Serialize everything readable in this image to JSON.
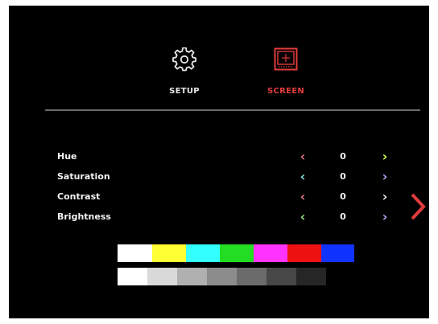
{
  "tabs": [
    {
      "label": "SETUP",
      "icon": "gear-icon",
      "color": "#e8e8e8",
      "active": false
    },
    {
      "label": "SCREEN",
      "icon": "screen-icon",
      "color": "#e23b3b",
      "active": true
    }
  ],
  "settings": [
    {
      "label": "Hue",
      "value": "0"
    },
    {
      "label": "Saturation",
      "value": "0"
    },
    {
      "label": "Contrast",
      "value": "0"
    },
    {
      "label": "Brightness",
      "value": "0"
    }
  ],
  "controls": {
    "decrease_glyph": "‹",
    "increase_glyph": "›",
    "decrease_color": "#e07080",
    "increase_color": "#b8a6ff",
    "next_page_icon": "chevron-right-icon",
    "next_page_color": "#e23b3b"
  },
  "color_bars": [
    "#ffffff",
    "#ffff33",
    "#33ffff",
    "#22dd22",
    "#ff33ff",
    "#ee1111",
    "#1133ff"
  ],
  "gray_bars": [
    "#ffffff",
    "#d9d9d9",
    "#b0b0b0",
    "#8c8c8c",
    "#6b6b6b",
    "#474747",
    "#262626"
  ]
}
